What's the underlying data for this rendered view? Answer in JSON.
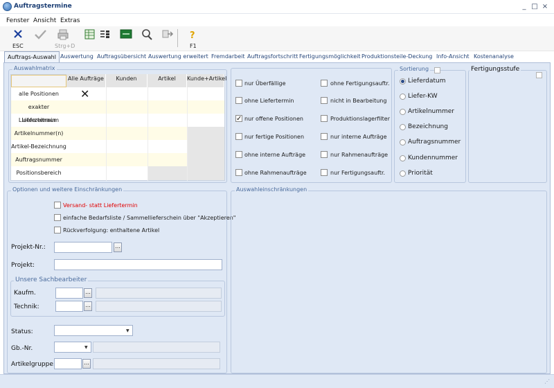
{
  "window": {
    "title": "Auftragstermine",
    "controls": {
      "minimize": "_",
      "maximize": "□",
      "close": "×"
    }
  },
  "menu": [
    "Fenster",
    "Ansicht",
    "Extras"
  ],
  "toolbar": {
    "esc_label": "ESC",
    "save_label": "Strg+D",
    "f1_label": "F1"
  },
  "tabs": [
    "Auftrags-Auswahl",
    "Auswertung",
    "Auftragsübersicht",
    "Auswertung erweitert",
    "Fremdarbeit",
    "Auftragsfortschritt",
    "Fertigungsmöglichkeit",
    "Produktionsteile-Deckung",
    "Info-Ansicht",
    "Kostenanalyse"
  ],
  "matrix": {
    "title": "Auswahlmatrix",
    "columns": [
      "Alle Aufträge",
      "Kunden",
      "Artikel",
      "Kunde+Artikel"
    ],
    "rows": [
      "alle Positionen",
      "exakter Liefertermin",
      "Lieferzeitraum",
      "Artikelnummer(n)",
      "Artikel-Bezeichnung",
      "Auftragsnummer",
      "Positionsbereich"
    ],
    "selected_mark": "✕"
  },
  "filters": {
    "left": [
      {
        "label": "nur Überfällige",
        "checked": false
      },
      {
        "label": "ohne Liefertermin",
        "checked": false
      },
      {
        "label": "nur offene Positionen",
        "checked": true
      },
      {
        "label": "nur fertige Positionen",
        "checked": false
      },
      {
        "label": "ohne interne Aufträge",
        "checked": false
      },
      {
        "label": "ohne Rahmenaufträge",
        "checked": false
      }
    ],
    "right": [
      {
        "label": "ohne Fertigungsauftr.",
        "checked": false
      },
      {
        "label": "nicht in Bearbeitung",
        "checked": false
      },
      {
        "label": "Produktionslagerfilter",
        "checked": false
      },
      {
        "label": "nur interne Aufträge",
        "checked": false
      },
      {
        "label": "nur Rahmenaufträge",
        "checked": false
      },
      {
        "label": "nur Fertigungsauftr.",
        "checked": false
      }
    ]
  },
  "sort": {
    "title": "Sortierung",
    "options": [
      "Lieferdatum",
      "Liefer-KW",
      "Artikelnummer",
      "Bezeichnung",
      "Auftragsnummer",
      "Kundennummer",
      "Priorität"
    ],
    "selected": "Lieferdatum"
  },
  "fertigungsstufe": {
    "title": "Fertigungsstufe"
  },
  "options": {
    "title": "Optionen und weitere Einschränkungen",
    "versand": "Versand- statt Liefertermin",
    "bedarf": "einfache Bedarfsliste / Sammellieferschein über \"Akzeptieren\"",
    "rueck": "Rückverfolgung: enthaltene Artikel",
    "colors": {
      "versand": "#e00000"
    }
  },
  "form": {
    "projekt_nr_label": "Projekt-Nr.:",
    "projekt_nr_value": "",
    "projekt_label": "Projekt:",
    "projekt_value": "",
    "sachbearbeiter_title": "Unsere Sachbearbeiter",
    "kaufm_label": "Kaufm.",
    "technik_label": "Technik:",
    "status_label": "Status:",
    "gbnr_label": "Gb.-Nr.",
    "artikelgruppe_label": "Artikelgruppe:",
    "dots": "..."
  },
  "restrictions": {
    "title": "Auswahleinschränkungen"
  },
  "colors": {
    "panel_bg": "#dfe8f5",
    "group_title": "#4a6b9c",
    "tab_text": "#26467a"
  }
}
